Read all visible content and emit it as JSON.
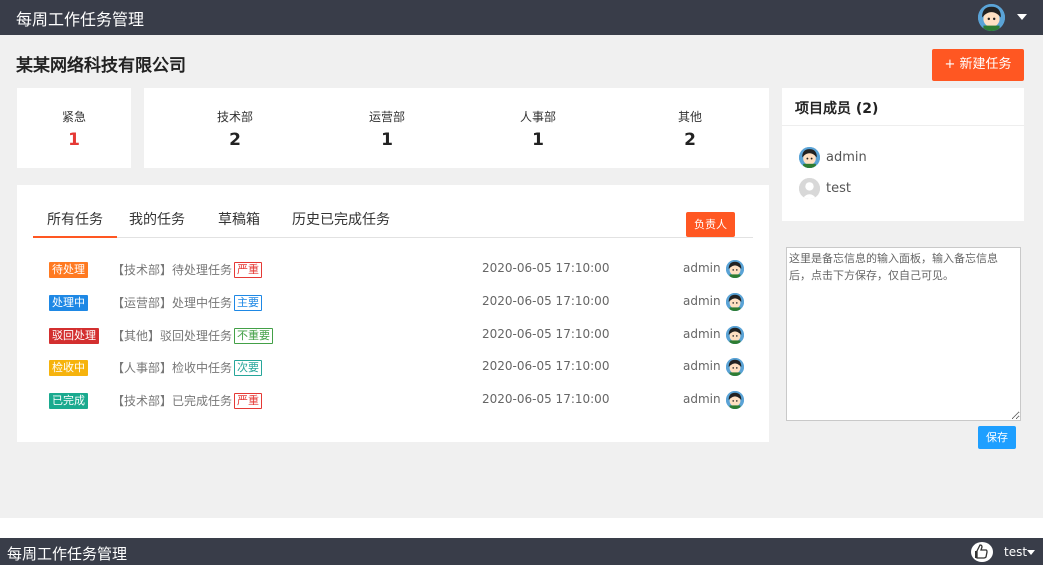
{
  "header": {
    "title": "每周工作任务管理",
    "avatar_icon": "user-avatar-icon"
  },
  "company": {
    "name": "某某网络科技有限公司"
  },
  "actions": {
    "new_task": "+ 新建任务"
  },
  "stats": {
    "urgent": {
      "label": "紧急",
      "value": "1"
    },
    "departments": [
      {
        "label": "技术部",
        "value": "2"
      },
      {
        "label": "运营部",
        "value": "1"
      },
      {
        "label": "人事部",
        "value": "1"
      },
      {
        "label": "其他",
        "value": "2"
      }
    ]
  },
  "members": {
    "title": "项目成员 (2)",
    "list": [
      {
        "name": "admin",
        "icon": "avatar-icon"
      },
      {
        "name": "test",
        "icon": "default-avatar-icon"
      }
    ]
  },
  "tabs": [
    "所有任务",
    "我的任务",
    "草稿箱",
    "历史已完成任务"
  ],
  "owner_button": "负责人",
  "tasks": [
    {
      "status": "待处理",
      "status_color": "#ff7a21",
      "text": "【技术部】待处理任务",
      "priority": "严重",
      "priority_color": "#e53935",
      "time": "2020-06-05 17:10:00",
      "owner": "admin"
    },
    {
      "status": "处理中",
      "status_color": "#1e88e5",
      "text": "【运营部】处理中任务",
      "priority": "主要",
      "priority_color": "#1e88e5",
      "time": "2020-06-05 17:10:00",
      "owner": "admin"
    },
    {
      "status": "驳回处理",
      "status_color": "#d32f2f",
      "text": "【其他】驳回处理任务",
      "priority": "不重要",
      "priority_color": "#43a047",
      "time": "2020-06-05 17:10:00",
      "owner": "admin"
    },
    {
      "status": "检收中",
      "status_color": "#f6b30d",
      "text": "【人事部】检收中任务",
      "priority": "次要",
      "priority_color": "#26a69a",
      "time": "2020-06-05 17:10:00",
      "owner": "admin"
    },
    {
      "status": "已完成",
      "status_color": "#1aaa8f",
      "text": "【技术部】已完成任务",
      "priority": "严重",
      "priority_color": "#e53935",
      "time": "2020-06-05 17:10:00",
      "owner": "admin"
    }
  ],
  "memo": {
    "text": "这里是备忘信息的输入面板，输入备忘信息后，点击下方保存，仅自己可见。",
    "save": "保存"
  },
  "footer": {
    "title": "每周工作任务管理",
    "user": "test",
    "icon": "thumbs-up-icon"
  }
}
